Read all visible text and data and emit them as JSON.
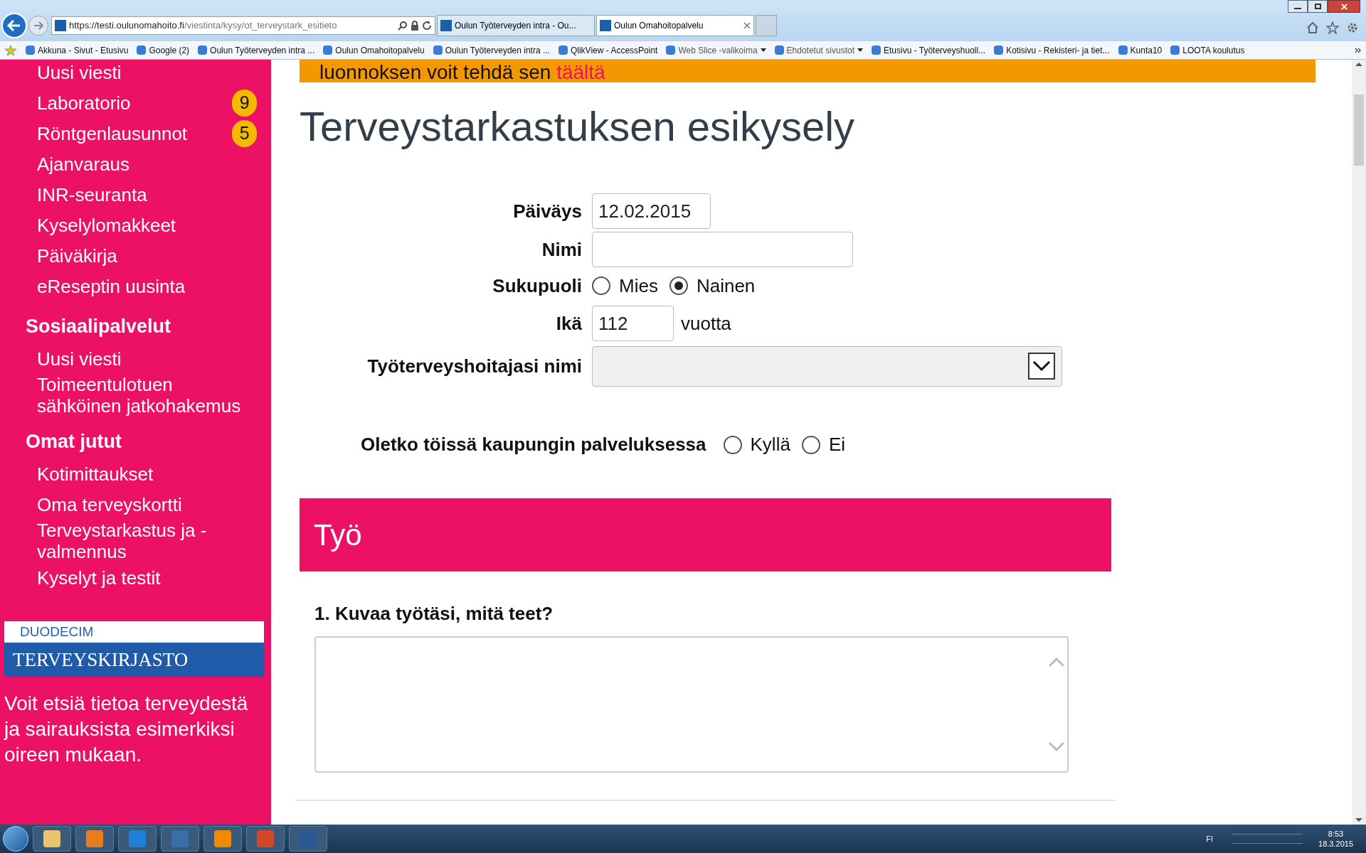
{
  "browser": {
    "url_host": "https://testi.oulunomahoito.fi",
    "url_path": "/viestinta/kysy/ot_terveystark_esitieto",
    "tabs": [
      {
        "title": "Oulun Työterveyden intra - Ou...",
        "selected": false
      },
      {
        "title": "Oulun Omahoitopalvelu",
        "selected": true
      }
    ],
    "favorites": [
      {
        "label": "Akkuna - Sivut - Etusivu",
        "dropdown": false
      },
      {
        "label": "Google (2)",
        "dropdown": false
      },
      {
        "label": "Oulun Työterveyden intra ...",
        "dropdown": false
      },
      {
        "label": "Oulun Omahoitopalvelu",
        "dropdown": false
      },
      {
        "label": "Oulun Työterveyden intra ...",
        "dropdown": false
      },
      {
        "label": "QlikView - AccessPoint",
        "dropdown": false
      },
      {
        "label": "Web Slice -valikoima",
        "dropdown": true
      },
      {
        "label": "Ehdotetut sivustot",
        "dropdown": true
      },
      {
        "label": "Etusivu - Työterveyshuoll...",
        "dropdown": false
      },
      {
        "label": "Kotisivu - Rekisteri- ja tiet...",
        "dropdown": false
      },
      {
        "label": "Kunta10",
        "dropdown": false
      },
      {
        "label": "LOOTA koulutus",
        "dropdown": false
      }
    ]
  },
  "sidebar": {
    "sections": [
      {
        "items": [
          {
            "label": "Uusi viesti"
          },
          {
            "label": "Laboratorio",
            "badge": "9"
          },
          {
            "label": "Röntgenlausunnot",
            "badge": "5"
          },
          {
            "label": "Ajanvaraus"
          },
          {
            "label": "INR-seuranta"
          },
          {
            "label": "Kyselylomakkeet"
          },
          {
            "label": "Päiväkirja"
          },
          {
            "label": "eReseptin uusinta"
          }
        ]
      },
      {
        "heading": "Sosiaalipalvelut",
        "items": [
          {
            "label": "Uusi viesti"
          },
          {
            "label": "Toimeentulotuen sähköinen jatkohakemus"
          }
        ]
      },
      {
        "heading": "Omat jutut",
        "items": [
          {
            "label": "Kotimittaukset"
          },
          {
            "label": "Oma terveyskortti"
          },
          {
            "label": "Terveystarkastus ja -valmennus"
          },
          {
            "label": "Kyselyt ja testit"
          }
        ]
      }
    ],
    "logo": {
      "top": "DUODECIM",
      "main": "TERVEYSKIRJASTO"
    },
    "promo": "Voit etsiä tietoa terveydestä ja sairauksista esimerkiksi oireen mukaan."
  },
  "banner": {
    "text": "luonnoksen voit tehdä sen",
    "link": "täältä"
  },
  "form": {
    "title": "Terveystarkastuksen esikysely",
    "fields": [
      {
        "kind": "text",
        "label": "Päiväys",
        "value": "12.02.2015"
      },
      {
        "kind": "text",
        "label": "Nimi"
      },
      {
        "kind": "radio",
        "label": "Sukupuoli",
        "options": [
          {
            "label": "Mies",
            "selected": false
          },
          {
            "label": "Nainen",
            "selected": true
          }
        ]
      },
      {
        "kind": "number",
        "label": "Ikä",
        "value": "112",
        "suffix": "vuotta"
      },
      {
        "kind": "select",
        "label": "Työterveyshoitajasi nimi"
      }
    ],
    "question": {
      "label": "Oletko töissä kaupungin palveluksessa",
      "options": [
        {
          "label": "Kyllä",
          "selected": false
        },
        {
          "label": "Ei",
          "selected": false
        }
      ]
    },
    "section_title": "Työ",
    "questions": [
      {
        "label": "1. Kuvaa työtäsi, mitä teet?"
      }
    ]
  },
  "taskbar": {
    "language": "FI",
    "time": "8:53",
    "date": "18.3.2015"
  }
}
